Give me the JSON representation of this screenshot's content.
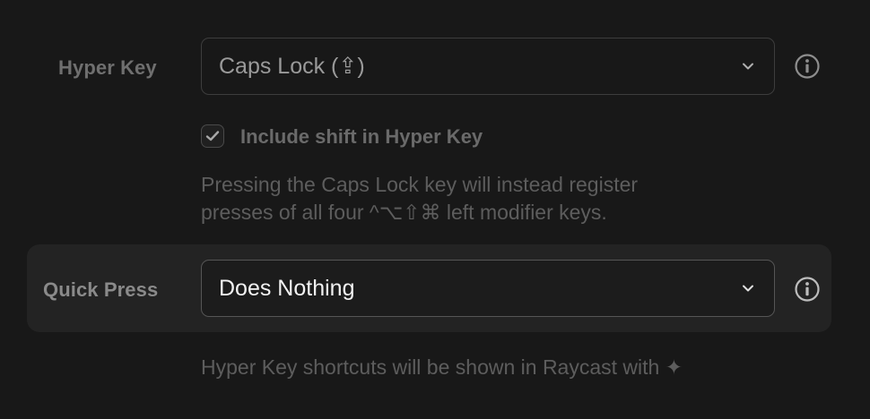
{
  "hyper_key": {
    "label": "Hyper Key",
    "selected": "Caps Lock (⇪)",
    "include_shift": {
      "checked": true,
      "label": "Include shift in Hyper Key"
    },
    "description_line1": "Pressing the Caps Lock key will instead register",
    "description_line2": "presses of all four ^⌥⇧⌘ left modifier keys."
  },
  "quick_press": {
    "label": "Quick Press",
    "selected": "Does Nothing",
    "description": "Hyper Key shortcuts will be shown in Raycast with ✦"
  },
  "icons": {
    "dropdown": "chevron-down-icon",
    "info": "info-icon",
    "check": "checkmark-icon"
  }
}
